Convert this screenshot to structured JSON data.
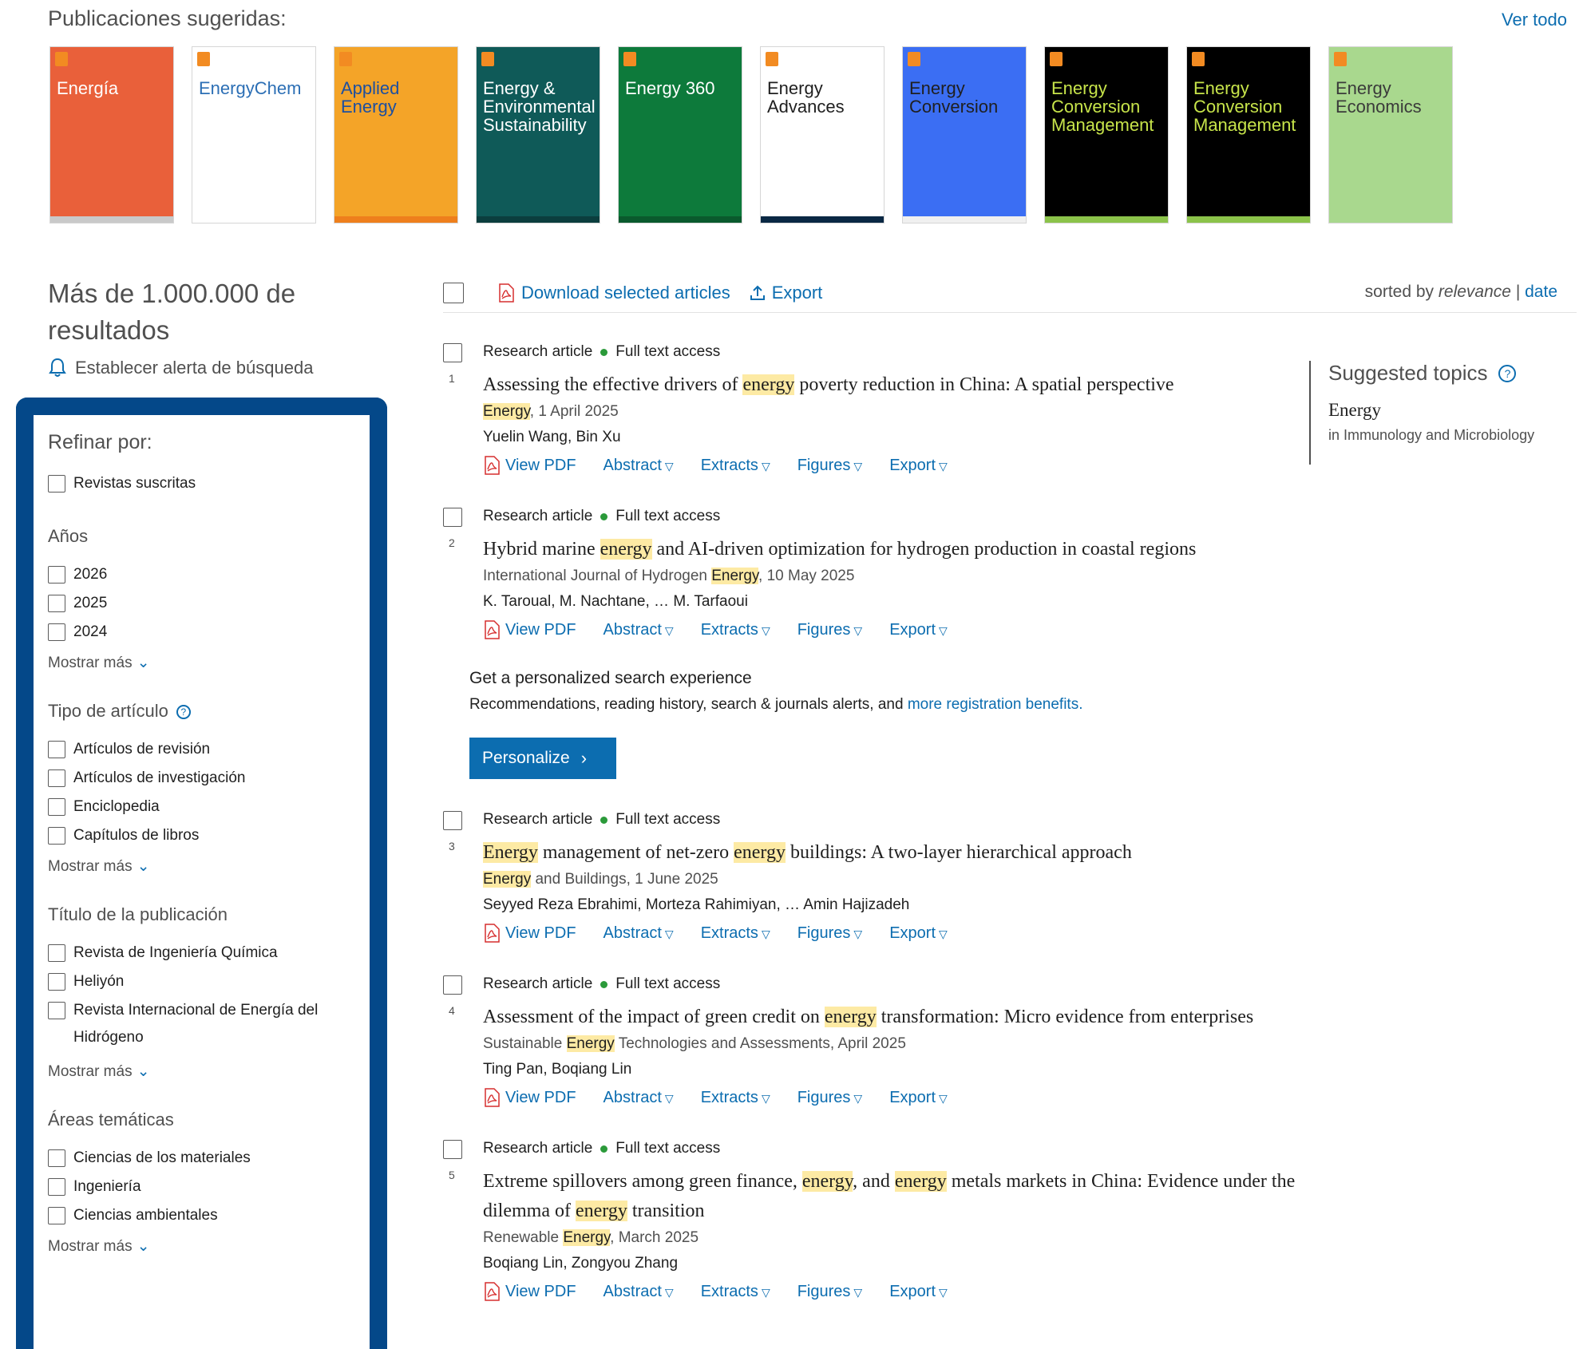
{
  "suggested": {
    "title": "Publicaciones sugeridas:",
    "see_all": "Ver todo",
    "covers": [
      {
        "label": "Energía",
        "bg": "#e9603a",
        "fg": "#ffffff",
        "bottom": "#c9c9c9"
      },
      {
        "label": "EnergyChem",
        "bg": "#ffffff",
        "fg": "#2c6fb5",
        "bottom": "#ffffff"
      },
      {
        "label": "Applied Energy",
        "bg": "#f4a428",
        "fg": "#1d4fa0",
        "bottom": "#ee7f1c"
      },
      {
        "label": "Energy & Environmental Sustainability",
        "bg": "#0f5a58",
        "fg": "#ffffff",
        "bottom": "#0b3e3e"
      },
      {
        "label": "Energy 360",
        "bg": "#0d7a3b",
        "fg": "#ffffff",
        "bottom": "#0a5a2d"
      },
      {
        "label": "Energy Advances",
        "bg": "#ffffff",
        "fg": "#1f1f1f",
        "bottom": "#0a2844"
      },
      {
        "label": "Energy Conversion",
        "bg": "#3b6ef3",
        "fg": "#1f1f1f",
        "bottom": "#f0f0f0"
      },
      {
        "label": "Energy Conversion Management",
        "bg": "#000000",
        "fg": "#c7e44a",
        "bottom": "#8bc34a"
      },
      {
        "label": "Energy Conversion Management",
        "bg": "#000000",
        "fg": "#c7e44a",
        "bottom": "#8bc34a"
      },
      {
        "label": "Energy Economics",
        "bg": "#a9d88e",
        "fg": "#3a3a3a",
        "bottom": "#a9d88e"
      }
    ]
  },
  "results_count": "Más de 1.000.000 de resultados",
  "alert_label": "Establecer alerta de búsqueda",
  "refine": {
    "title": "Refinar por:",
    "subscribed": "Revistas suscritas",
    "years": {
      "title": "Años",
      "items": [
        "2026",
        "2025",
        "2024"
      ],
      "more": "Mostrar más"
    },
    "article_type": {
      "title": "Tipo de artículo",
      "items": [
        "Artículos de revisión",
        "Artículos de investigación",
        "Enciclopedia",
        "Capítulos de libros"
      ],
      "more": "Mostrar más"
    },
    "publication": {
      "title": "Título de la publicación",
      "items": [
        "Revista de Ingeniería Química",
        "Heliyón",
        "Revista Internacional de Energía del Hidrógeno"
      ],
      "more": "Mostrar más"
    },
    "areas": {
      "title": "Áreas temáticas",
      "items": [
        "Ciencias de los materiales",
        "Ingeniería",
        "Ciencias ambientales"
      ],
      "more": "Mostrar más"
    }
  },
  "toolbar": {
    "download": "Download selected articles",
    "export": "Export",
    "sorted_by": "sorted by",
    "relevance": "relevance",
    "sep": "|",
    "date": "date"
  },
  "common": {
    "type": "Research article",
    "access": "Full text access",
    "view_pdf": "View PDF",
    "abstract": "Abstract",
    "extracts": "Extracts",
    "figures": "Figures",
    "export": "Export"
  },
  "results": [
    {
      "num": "1",
      "title_parts": [
        "Assessing the effective drivers of ",
        "energy",
        " poverty reduction in China: A spatial perspective"
      ],
      "source_parts": [
        "",
        "Energy",
        ", 1 April 2025"
      ],
      "authors": "Yuelin Wang, Bin Xu"
    },
    {
      "num": "2",
      "title_parts": [
        "Hybrid marine ",
        "energy",
        " and AI-driven optimization for hydrogen production in coastal regions"
      ],
      "source_parts": [
        "International Journal of Hydrogen ",
        "Energy",
        ", 10 May 2025"
      ],
      "authors": "K. Taroual, M. Nachtane, … M. Tarfaoui"
    },
    {
      "num": "3",
      "title_parts": [
        "",
        "Energy",
        " management of net-zero ",
        "energy",
        " buildings: A two-layer hierarchical approach"
      ],
      "source_parts": [
        "",
        "Energy",
        " and Buildings, 1 June 2025"
      ],
      "authors": "Seyyed Reza Ebrahimi, Morteza Rahimiyan, … Amin Hajizadeh"
    },
    {
      "num": "4",
      "title_parts": [
        "Assessment of the impact of green credit on ",
        "energy",
        " transformation: Micro evidence from enterprises"
      ],
      "source_parts": [
        "Sustainable ",
        "Energy",
        " Technologies and Assessments, April 2025"
      ],
      "authors": "Ting Pan, Boqiang Lin"
    },
    {
      "num": "5",
      "title_parts": [
        "Extreme spillovers among green finance, ",
        "energy",
        ", and ",
        "energy",
        " metals markets in China: Evidence under the dilemma of ",
        "energy",
        " transition"
      ],
      "source_parts": [
        "Renewable ",
        "Energy",
        ", March 2025"
      ],
      "authors": "Boqiang Lin, Zongyou Zhang"
    }
  ],
  "personalize": {
    "heading": "Get a personalized search experience",
    "text": "Recommendations, reading history, search & journals alerts, and",
    "link": "more registration benefits.",
    "button": "Personalize"
  },
  "topics": {
    "title": "Suggested topics",
    "name": "Energy",
    "sub": "in Immunology and Microbiology"
  }
}
